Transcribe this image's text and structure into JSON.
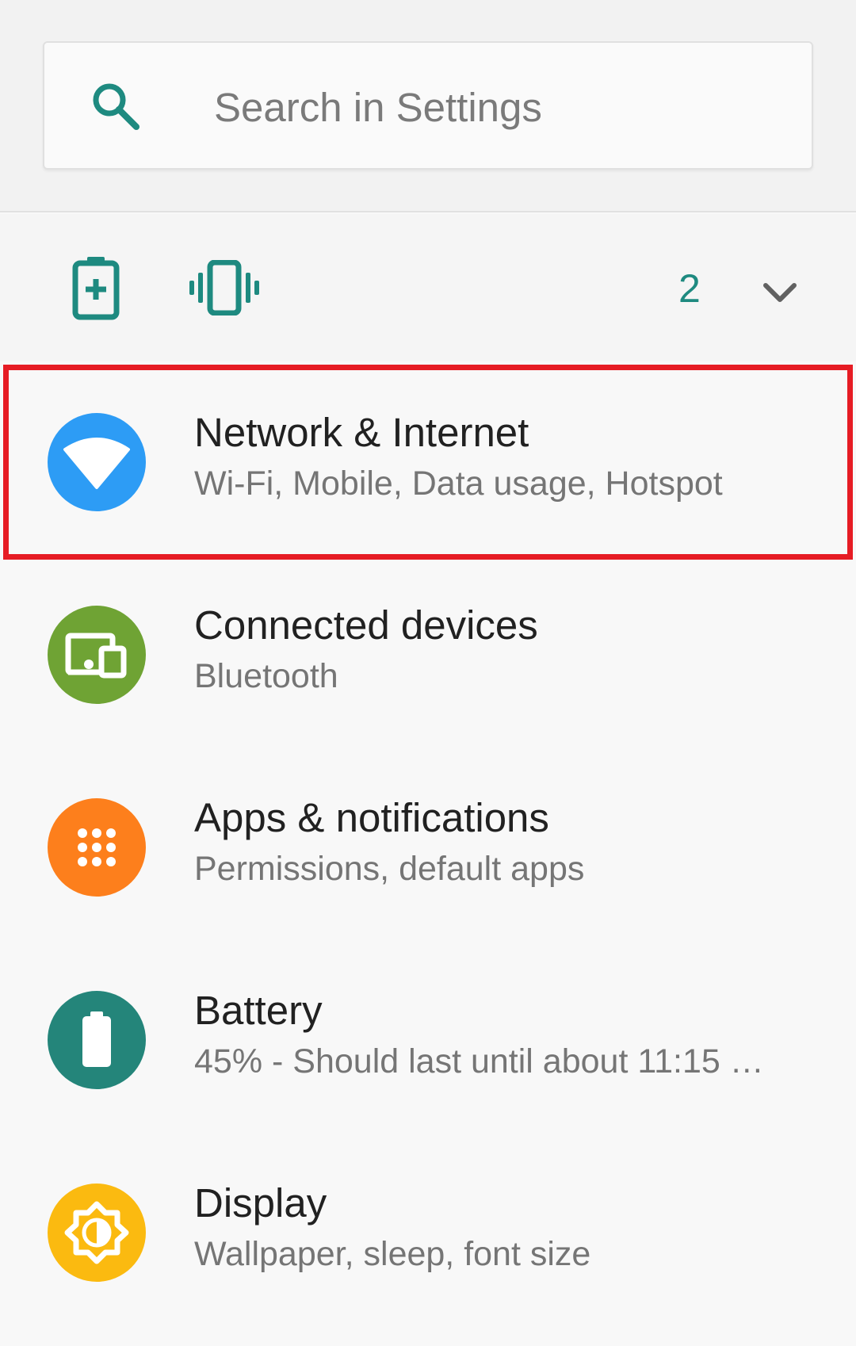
{
  "search": {
    "placeholder": "Search in Settings"
  },
  "suggestions": {
    "count": "2",
    "icons": [
      "battery-saver-icon",
      "vibrate-icon",
      "chevron-down-icon"
    ]
  },
  "settings_items": [
    {
      "title": "Network & Internet",
      "summary": "Wi-Fi, Mobile, Data usage, Hotspot",
      "icon": "wifi-icon",
      "color": "#2d9cf5"
    },
    {
      "title": "Connected devices",
      "summary": "Bluetooth",
      "icon": "devices-icon",
      "color": "#6fa334"
    },
    {
      "title": "Apps & notifications",
      "summary": "Permissions, default apps",
      "icon": "apps-grid-icon",
      "color": "#fd7f1c"
    },
    {
      "title": "Battery",
      "summary": "45% - Should last until about 11:15 …",
      "icon": "battery-icon",
      "color": "#24857a"
    },
    {
      "title": "Display",
      "summary": "Wallpaper, sleep, font size",
      "icon": "brightness-icon",
      "color": "#fbba10"
    }
  ],
  "colors": {
    "accent": "#1e8a80",
    "highlight": "#e61c24"
  }
}
